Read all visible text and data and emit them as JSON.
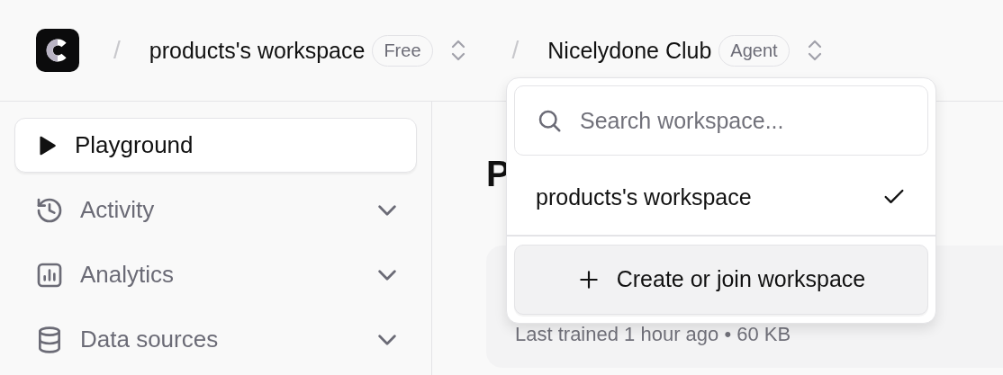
{
  "header": {
    "breadcrumbs": [
      {
        "separator": "/",
        "label": "products's workspace",
        "badge": "Free"
      },
      {
        "separator": "/",
        "label": "Nicelydone Club",
        "badge": "Agent"
      }
    ]
  },
  "sidebar": {
    "items": [
      {
        "label": "Playground",
        "kind": "link",
        "selected": true
      },
      {
        "label": "Activity",
        "kind": "group",
        "selected": false,
        "expanded": false
      },
      {
        "label": "Analytics",
        "kind": "group",
        "selected": false,
        "expanded": false
      },
      {
        "label": "Data sources",
        "kind": "group",
        "selected": false,
        "expanded": false
      }
    ]
  },
  "main": {
    "heading": "P",
    "card": {
      "meta": "Last trained 1 hour ago • 60 KB"
    }
  },
  "workspace_menu": {
    "search": {
      "placeholder": "Search workspace..."
    },
    "items": [
      {
        "label": "products's workspace",
        "selected": true
      }
    ],
    "action": "Create or join workspace"
  }
}
